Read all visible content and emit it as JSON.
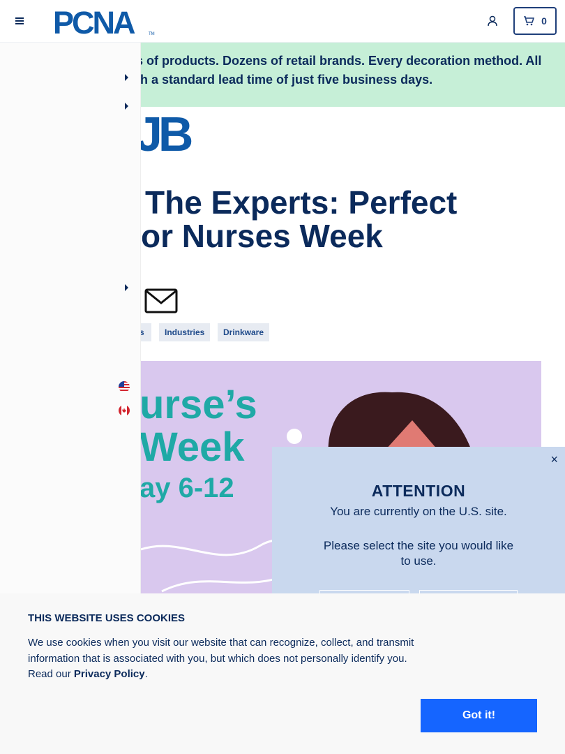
{
  "header": {
    "logo_text": "PCNA",
    "logo_mark": "TM",
    "cart_count": "0",
    "menu_icon": "hamburger-menu-icon",
    "account_icon": "user-icon",
    "cart_icon": "cart-icon"
  },
  "banner": {
    "line1": "ls of products. Dozens of retail brands. Every decoration method. All",
    "line2": "th a standard lead time of just five business days."
  },
  "hub_logo_fragment": "JB",
  "article": {
    "title_line1": "The Experts: Perfect",
    "title_line2": "or Nurses Week",
    "tags": [
      "s",
      "Industries",
      "Drinkware"
    ]
  },
  "hero": {
    "line1": "urse’s",
    "line2": "Week",
    "line3": "ay 6-12"
  },
  "modal": {
    "title": "ATTENTION",
    "line1": "You are currently on the U.S. site.",
    "line2": "Please select the site you would like to use.",
    "close": "×"
  },
  "cookie": {
    "title": "THIS WEBSITE USES COOKIES",
    "text": "We use cookies when you visit our website that can recognize, collect, and transmit information that is associated with you, but which does not personally identify you. Read our ",
    "link": "Privacy Policy",
    "text_end": ".",
    "button": "Got it!"
  },
  "colors": {
    "navy": "#0b2a5b",
    "banner_green": "#c6efd7",
    "modal_blue": "#c9d8ee",
    "hero_lavender": "#d9c8ee",
    "cta_blue": "#1565ff"
  }
}
